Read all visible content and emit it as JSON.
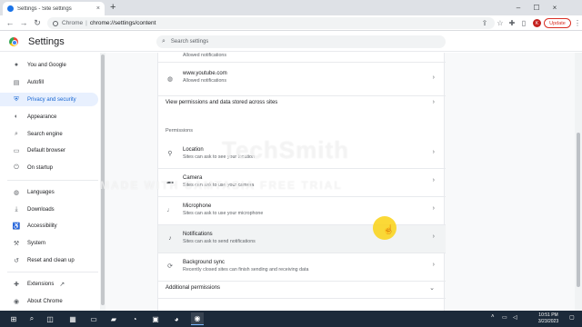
{
  "browser": {
    "tab_title": "Settings - Site settings",
    "tab_close": "×",
    "new_tab": "+",
    "minimize": "–",
    "maximize": "☐",
    "close": "×",
    "omnibox_origin": "Chrome",
    "omnibox_separator": "|",
    "omnibox_path": "chrome://settings/content",
    "update_label": "Update",
    "avatar_letter": "K"
  },
  "header": {
    "title": "Settings",
    "search_placeholder": "Search settings"
  },
  "sidebar": {
    "items": [
      {
        "label": "You and Google",
        "icon": "person-icon"
      },
      {
        "label": "Autofill",
        "icon": "autofill-icon"
      },
      {
        "label": "Privacy and security",
        "icon": "shield-icon",
        "active": true
      },
      {
        "label": "Appearance",
        "icon": "palette-icon"
      },
      {
        "label": "Search engine",
        "icon": "search-icon"
      },
      {
        "label": "Default browser",
        "icon": "browser-icon"
      },
      {
        "label": "On startup",
        "icon": "power-icon"
      },
      {
        "label": "Languages",
        "icon": "globe-icon"
      },
      {
        "label": "Downloads",
        "icon": "download-icon"
      },
      {
        "label": "Accessibility",
        "icon": "accessibility-icon"
      },
      {
        "label": "System",
        "icon": "wrench-icon"
      },
      {
        "label": "Reset and clean up",
        "icon": "reset-icon"
      },
      {
        "label": "Extensions",
        "icon": "puzzle-icon"
      },
      {
        "label": "About Chrome",
        "icon": "chrome-icon"
      }
    ]
  },
  "main": {
    "top_partial_text": "Allowed notifications",
    "youtube": {
      "title": "www.youtube.com",
      "subtitle": "Allowed notifications"
    },
    "view_permissions_label": "View permissions and data stored across sites",
    "permissions_heading": "Permissions",
    "permissions": [
      {
        "title": "Location",
        "subtitle": "Sites can ask to see your location",
        "icon": "location-icon"
      },
      {
        "title": "Camera",
        "subtitle": "Sites can ask to use your camera",
        "icon": "camera-icon"
      },
      {
        "title": "Microphone",
        "subtitle": "Sites can ask to use your microphone",
        "icon": "microphone-icon"
      },
      {
        "title": "Notifications",
        "subtitle": "Sites can ask to send notifications",
        "icon": "bell-icon"
      },
      {
        "title": "Background sync",
        "subtitle": "Recently closed sites can finish sending and receiving data",
        "icon": "sync-icon"
      }
    ],
    "additional_permissions": "Additional permissions"
  },
  "watermark": {
    "line1": "TechSmith",
    "line2": "MADE WITH CAMTASIA FREE TRIAL"
  },
  "taskbar": {
    "clock_time": "10:51 PM",
    "clock_date": "3/23/2023"
  },
  "colors": {
    "accent": "#1a73e8",
    "active_nav_bg": "#e8f0fe",
    "update_red": "#d93025",
    "cursor_highlight": "#fad214"
  }
}
